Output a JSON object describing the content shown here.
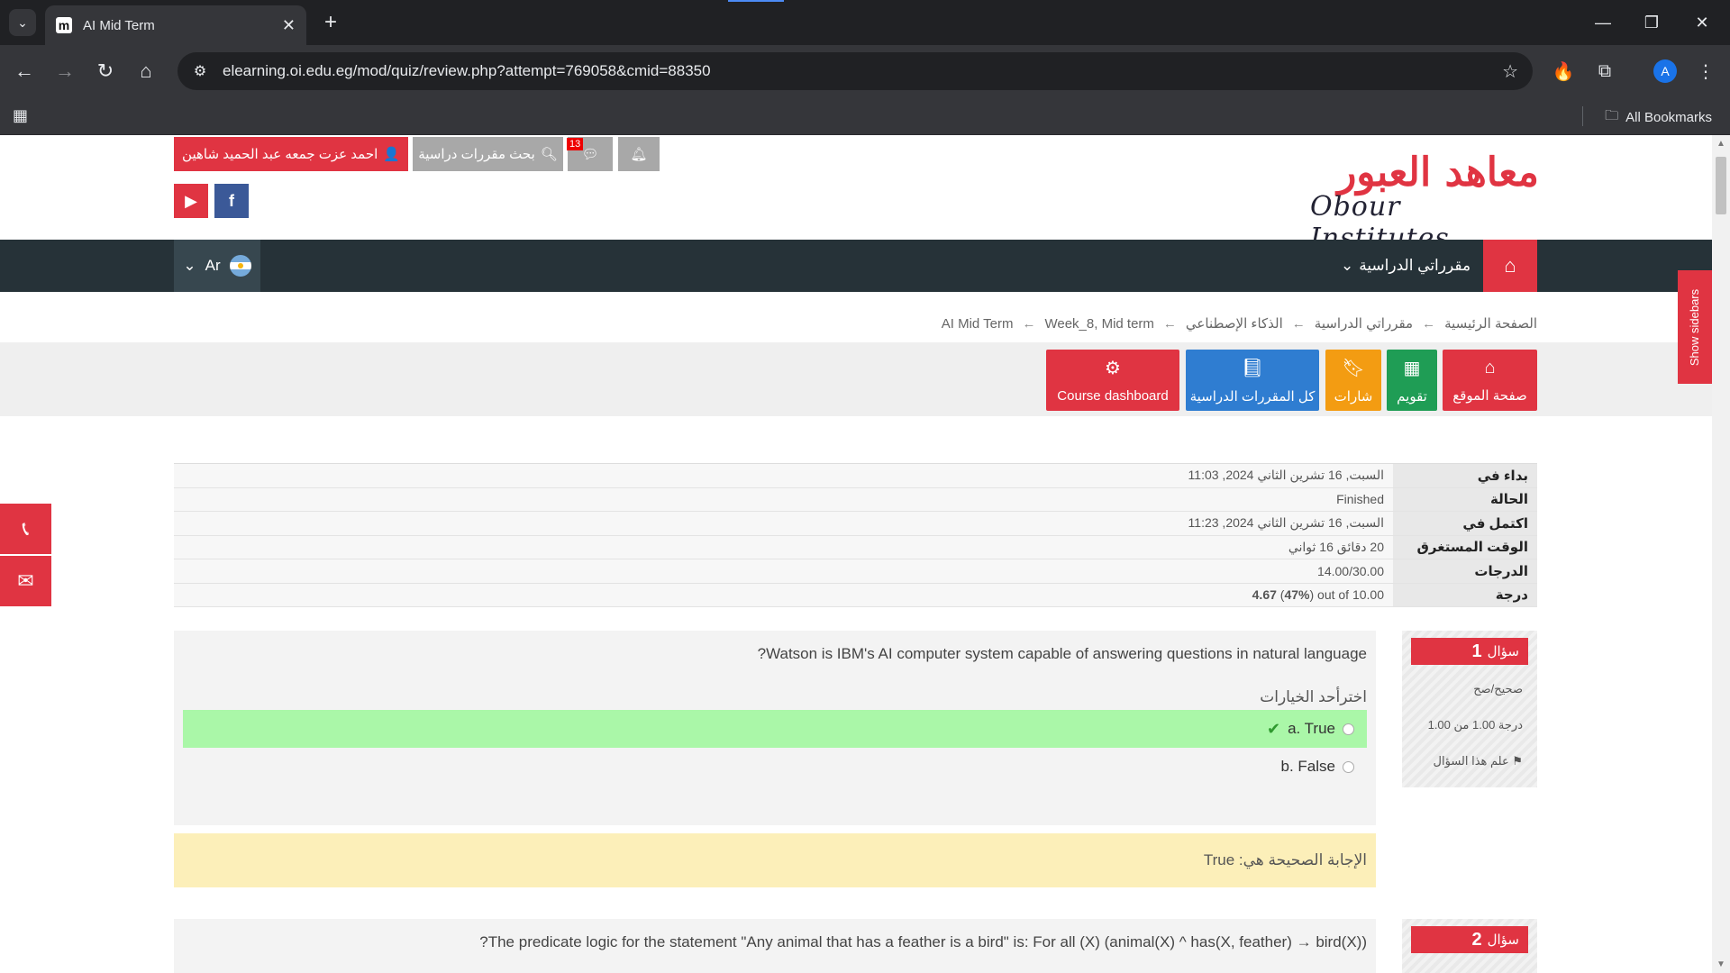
{
  "browser": {
    "tab_title": "AI Mid Term",
    "url": "elearning.oi.edu.eg/mod/quiz/review.php?attempt=769058&cmid=88350",
    "all_bookmarks": "All Bookmarks",
    "profile_initial": "A",
    "favicon_letter": "m"
  },
  "header": {
    "user_name": "احمد عزت جمعه عبد الحميد شاهين",
    "search_label": "بحث مقررات دراسية",
    "message_count": "13",
    "logo_ar": "معاهد العبور",
    "logo_en": "Obour Institutes",
    "facebook_glyph": "f"
  },
  "nav": {
    "courses_label": "مقرراتي الدراسية",
    "lang_label": "Ar",
    "show_sidebars": "Show sidebars"
  },
  "breadcrumb": [
    "الصفحة الرئيسية",
    "مقرراتي الدراسية",
    "الذكاء الإصطناعي",
    "Week_8, Mid term",
    "AI Mid Term"
  ],
  "quick_links": {
    "home": "صفحة الموقع",
    "calendar": "تقويم",
    "badges": "شارات",
    "all_courses": "كل المقررات الدراسية",
    "course_dashboard": "Course dashboard"
  },
  "colors": {
    "home": "#e03442",
    "calendar": "#1f9d55",
    "badges": "#f39c12",
    "all_courses": "#2f7dd1",
    "course_dashboard": "#e03442"
  },
  "summary": [
    {
      "label": "بداء في",
      "value": "السبت, 16 تشرين الثاني 2024, 11:03"
    },
    {
      "label": "الحالة",
      "value": "Finished"
    },
    {
      "label": "اكتمل في",
      "value": "السبت, 16 تشرين الثاني 2024, 11:23"
    },
    {
      "label": "الوقت المستغرق",
      "value": "20 دقائق 16 ثواني"
    },
    {
      "label": "الدرجات",
      "value": "14.00/30.00"
    },
    {
      "label": "درجة",
      "grade": "4.67",
      "pct": "47%",
      "out_of": "out of 10.00"
    }
  ],
  "questions": [
    {
      "label": "سؤال",
      "number": "1",
      "state": "صحيح/صح",
      "mark": "درجة 1.00 من 1.00",
      "flag": "علم هذا السؤال",
      "text": "Watson is IBM's AI computer system capable of answering questions in natural language?",
      "prompt": "اخترأحد الخيارات",
      "answers": [
        "a. True",
        "b. False"
      ],
      "feedback": "الإجابة الصحيحة هي: True"
    },
    {
      "label": "سؤال",
      "number": "2",
      "text": "The predicate logic for the statement \"Any animal that has a feather is a bird\" is: For all (X) (animal(X) ^ has(X, feather) → bird(X))?"
    }
  ]
}
